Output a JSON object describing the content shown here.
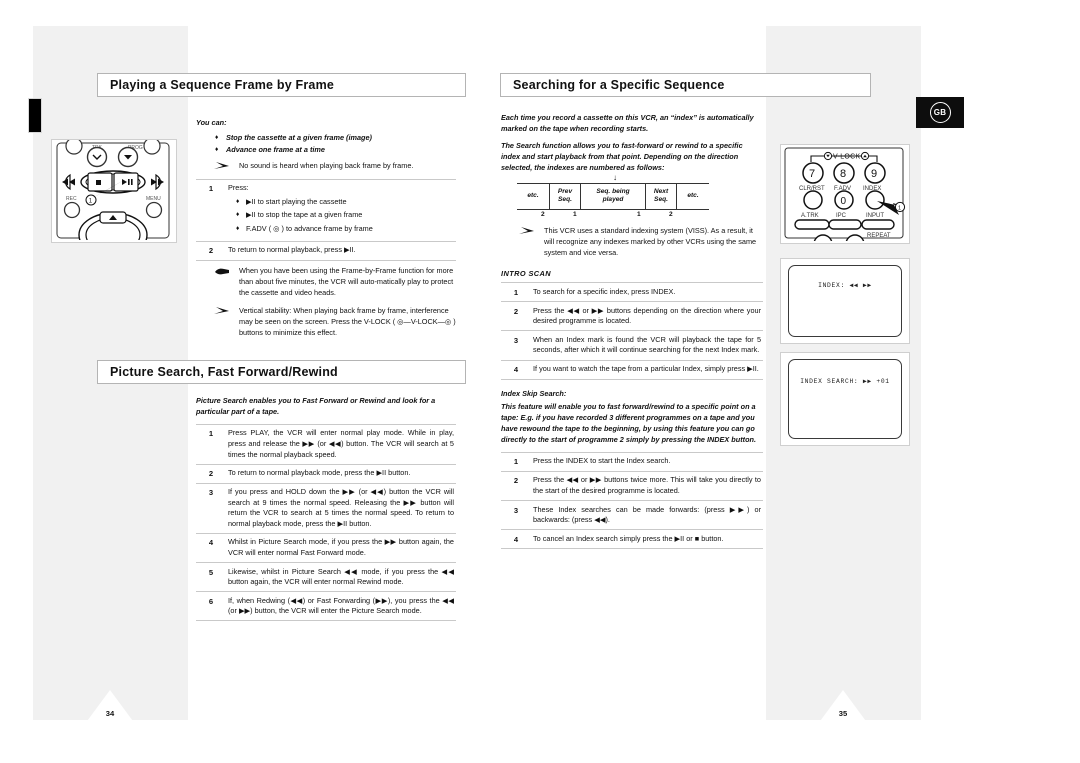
{
  "document": {
    "language_badge": "GB",
    "left_page_number": "34",
    "right_page_number": "35"
  },
  "left_page": {
    "section1": {
      "heading": "Playing a Sequence Frame by Frame",
      "lead_label": "You can:",
      "bullets": [
        "Stop the cassette at a given frame (image)",
        "Advance one frame at a time"
      ],
      "note": "No sound is heard when playing back frame by frame.",
      "steps": [
        {
          "n": "1",
          "text": "Press:",
          "sub": [
            "▶II to start playing the cassette",
            "▶II to stop the tape at a given frame",
            "F.ADV ( ◎ ) to advance frame by frame"
          ]
        },
        {
          "n": "2",
          "text": "To return to normal playback, press ▶II."
        }
      ],
      "tip_hand": "When you have been using the Frame-by-Frame function for more than about five minutes, the VCR will auto-matically play to protect the cassette and video heads.",
      "tip_arrow": "Vertical stability: When playing back frame by frame, interference may be seen on the screen. Press the V-LOCK ( ◎—V-LOCK—◎ ) buttons to minimize this effect."
    },
    "section2": {
      "heading": "Picture Search, Fast Forward/Rewind",
      "lead": "Picture Search enables you to Fast Forward or Rewind and look for a particular part of a tape.",
      "steps": [
        {
          "n": "1",
          "text": "Press PLAY, the VCR will enter normal play mode. While in play, press and release the ▶▶ (or ◀◀) button. The VCR will search at 5 times the normal playback speed."
        },
        {
          "n": "2",
          "text": "To return to normal playback mode, press the ▶II button."
        },
        {
          "n": "3",
          "text": "If you press and HOLD down the ▶▶ (or ◀◀) button the VCR will search at 9 times the normal speed. Releasing the ▶▶ button will return the VCR to search at 5 times the normal speed. To return to normal playback mode, press the ▶II button."
        },
        {
          "n": "4",
          "text": "Whilst in Picture Search mode, if you press the ▶▶ button again, the VCR will enter normal Fast Forward mode."
        },
        {
          "n": "5",
          "text": "Likewise, whilst in Picture Search ◀◀ mode, if you press the ◀◀ button again, the VCR will enter normal Rewind mode."
        },
        {
          "n": "6",
          "text": "If, when Redwing (◀◀) or Fast Forwarding (▶▶), you press the ◀◀ (or ▶▶) button, the VCR will enter the Picture Search mode."
        }
      ]
    },
    "remote": {
      "labels": [
        "TRK",
        "PROG",
        "REC",
        "MENU"
      ],
      "callout": "1",
      "buttons": [
        "◀◀",
        "■",
        "▶II",
        "▶▶"
      ]
    }
  },
  "right_page": {
    "heading": "Searching for a Specific Sequence",
    "intro1": "Each time you record a cassette on this VCR, an “index” is automatically marked on the tape when recording starts.",
    "intro2": "The Search function allows you to fast-forward or rewind to a specific index and start playback from that point. Depending on the direction selected, the indexes are numbered as follows:",
    "index_table": {
      "pointer": "↓",
      "cells": [
        "etc.",
        "Prev Seq.",
        "Seq. being played",
        "Next Seq.",
        "etc."
      ],
      "cell_line1": [
        "etc.",
        "Prev",
        "Seq. being",
        "Next",
        "etc."
      ],
      "cell_line2": [
        "",
        "Seq.",
        "played",
        "Seq.",
        ""
      ],
      "numbers": [
        "2",
        "1",
        "1",
        "2"
      ]
    },
    "note_viss": "This VCR uses a standard indexing system (VISS). As a result, it will recognize any indexes marked by other VCRs using the same system and vice versa.",
    "intro_scan": {
      "title": "INTRO SCAN",
      "steps": [
        {
          "n": "1",
          "text": "To search for a specific index, press INDEX."
        },
        {
          "n": "2",
          "text": "Press the ◀◀ or ▶▶ buttons depending on the direction where your desired programme is located."
        },
        {
          "n": "3",
          "text": "When an Index mark is found the VCR will playback the tape for 5 seconds, after which it will continue searching for the next Index mark."
        },
        {
          "n": "4",
          "text": "If you want to watch the tape from a particular Index, simply press ▶II."
        }
      ]
    },
    "index_skip": {
      "title": "Index Skip Search:",
      "lead": "This feature will enable you to fast forward/rewind to a specific point on a tape: E.g. if you have recorded 3 different programmes on a tape and you have rewound the tape to the beginning, by using this feature you can go directly to the start of programme 2 simply by pressing the INDEX button.",
      "steps": [
        {
          "n": "1",
          "text": "Press the INDEX to start the Index search."
        },
        {
          "n": "2",
          "text": "Press the ◀◀ or ▶▶ buttons twice more. This will take you directly to the start of the desired programme is located."
        },
        {
          "n": "3",
          "text": "These Index searches can be made forwards: (press ▶▶) or backwards: (press ◀◀)."
        },
        {
          "n": "4",
          "text": "To cancel an Index search simply press the ▶II or ■ button."
        }
      ]
    },
    "remote": {
      "vlock_label": "V-LOCK",
      "keys": [
        "7",
        "8",
        "9",
        "0"
      ],
      "key_labels": [
        "CLR/RST",
        "F.ADV",
        "INDEX"
      ],
      "bar_labels": [
        "A.TRK",
        "IPC",
        "INPUT"
      ],
      "repeat_label": "REPEAT",
      "callout": "1"
    },
    "osd": {
      "screen1": "INDEX:  ◀◀ ▶▶",
      "screen2": "INDEX SEARCH:  ▶▶  +01"
    }
  }
}
